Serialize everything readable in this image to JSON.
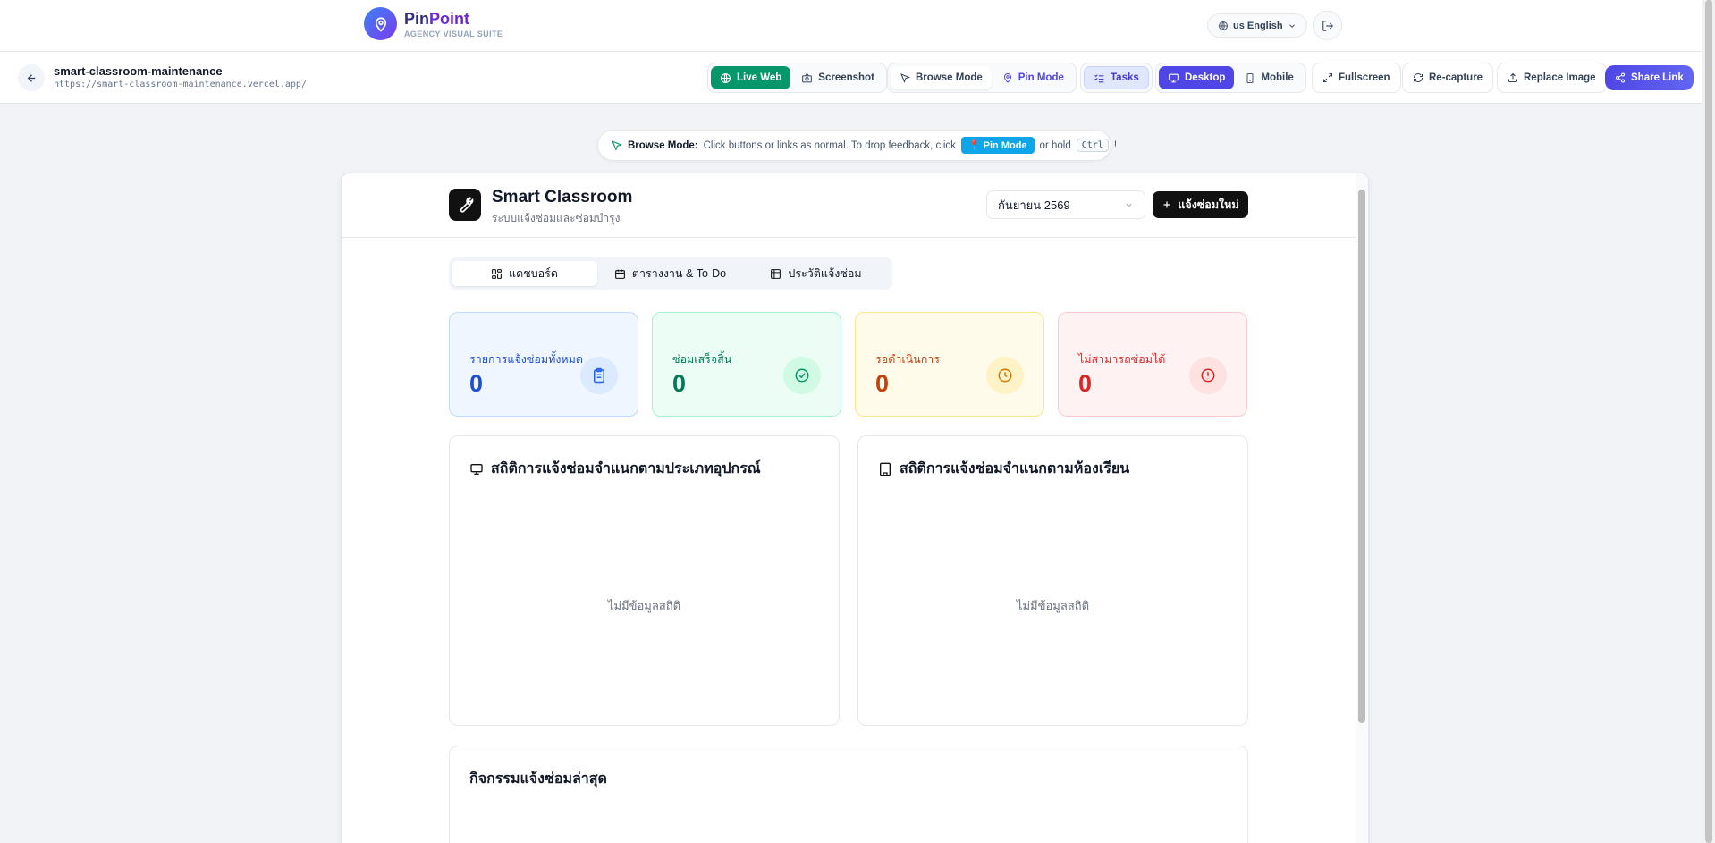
{
  "brand": {
    "name_a": "Pin",
    "name_b": "Point",
    "subtitle": "AGENCY VISUAL SUITE"
  },
  "header": {
    "language": "us English"
  },
  "project": {
    "name": "smart-classroom-maintenance",
    "url": "https://smart-classroom-maintenance.vercel.app/"
  },
  "toolbar": {
    "live_web": "Live Web",
    "screenshot": "Screenshot",
    "browse_mode": "Browse Mode",
    "pin_mode": "Pin Mode",
    "tasks": "Tasks",
    "desktop": "Desktop",
    "mobile": "Mobile",
    "fullscreen": "Fullscreen",
    "recapture": "Re-capture",
    "replace_image": "Replace Image",
    "share_link": "Share Link"
  },
  "hint": {
    "label": "Browse Mode:",
    "text": "Click buttons or links as normal. To drop feedback, click",
    "chip": "📍 Pin Mode",
    "or_hold": "or hold",
    "key": "Ctrl",
    "end": "!"
  },
  "app": {
    "title": "Smart Classroom",
    "subtitle": "ระบบแจ้งซ่อมและซ่อมบำรุง",
    "month": "กันยายน 2569",
    "new_report": "แจ้งซ่อมใหม่",
    "tabs": [
      "แดชบอร์ด",
      "ตารางงาน & To-Do",
      "ประวัติแจ้งซ่อม"
    ],
    "stats": [
      {
        "label": "รายการแจ้งซ่อมทั้งหมด",
        "value": "0",
        "icon": "clipboard-icon"
      },
      {
        "label": "ซ่อมเสร็จสิ้น",
        "value": "0",
        "icon": "check-circle-icon"
      },
      {
        "label": "รอดำเนินการ",
        "value": "0",
        "icon": "clock-icon"
      },
      {
        "label": "ไม่สามารถซ่อมได้",
        "value": "0",
        "icon": "alert-circle-icon"
      }
    ],
    "panel_device": {
      "title": "สถิติการแจ้งซ่อมจำแนกตามประเภทอุปกรณ์",
      "empty": "ไม่มีข้อมูลสถิติ"
    },
    "panel_room": {
      "title": "สถิติการแจ้งซ่อมจำแนกตามห้องเรียน",
      "empty": "ไม่มีข้อมูลสถิติ"
    },
    "panel_activity": {
      "title": "กิจกรรมแจ้งซ่อมล่าสุด"
    }
  },
  "colors": {
    "brand": "#4f46e5",
    "live": "#059669",
    "pin": "#0ea5e9"
  }
}
